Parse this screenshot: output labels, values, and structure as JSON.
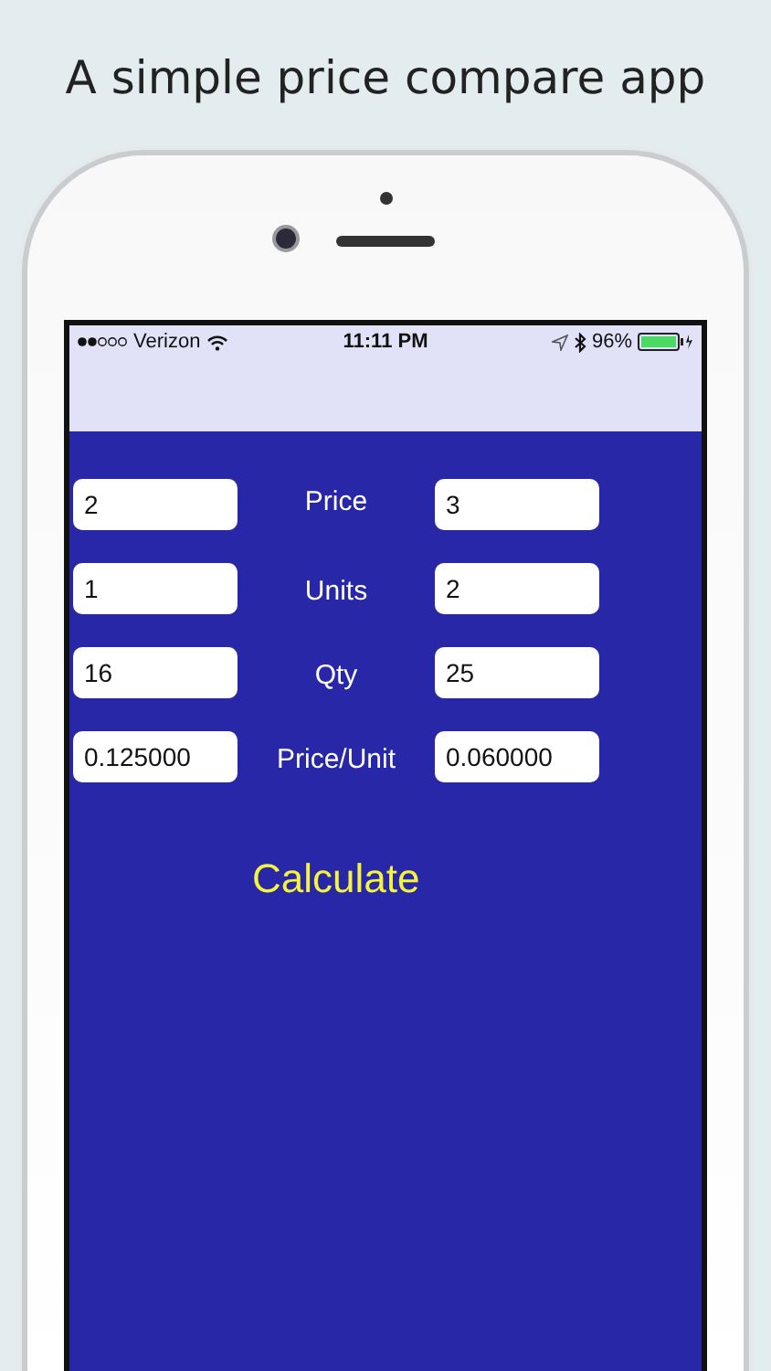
{
  "headline": "A simple price compare app",
  "status_bar": {
    "carrier": "Verizon",
    "time": "11:11 PM",
    "battery": "96%"
  },
  "rows": [
    {
      "label": "Price",
      "left": {
        "value": "2"
      },
      "right": {
        "value": "3"
      }
    },
    {
      "label": "Units",
      "left": {
        "value": "1"
      },
      "right": {
        "value": "2"
      }
    },
    {
      "label": "Qty",
      "left": {
        "value": "16"
      },
      "right": {
        "value": "25"
      }
    },
    {
      "label": "Price/Unit",
      "left": {
        "value": "0.125000"
      },
      "right": {
        "value": "0.060000"
      }
    }
  ],
  "button": "Calculate"
}
